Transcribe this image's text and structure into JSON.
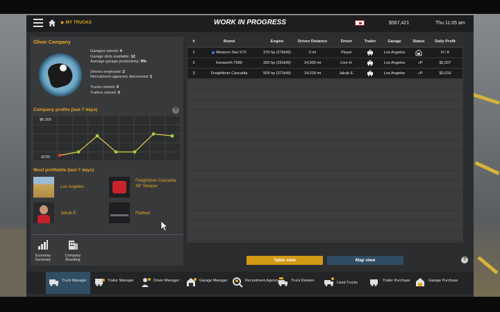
{
  "header": {
    "breadcrumb": "MY TRUCKS",
    "title": "WORK IN PROGRESS",
    "money": "$567,421",
    "time": "Thu 11:05 am"
  },
  "company": {
    "name": "Oliver Company",
    "stats": [
      {
        "label": "Garages owned:",
        "value": "4"
      },
      {
        "label": "Garage slots available:",
        "value": "12"
      },
      {
        "label": "Average garage productivity:",
        "value": "9%"
      },
      {
        "label": "Drivers employed:",
        "value": "2"
      },
      {
        "label": "Recruitment agencies discovered:",
        "value": "1"
      },
      {
        "label": "Trucks owned:",
        "value": "3"
      },
      {
        "label": "Trailers owned:",
        "value": "3"
      }
    ]
  },
  "profits": {
    "title": "Company profits (last 7 days)",
    "help": "?"
  },
  "chart_data": {
    "type": "line",
    "title": "Company profits (last 7 days)",
    "y_tick_labels": [
      "$6,300",
      "-$700"
    ],
    "ylim": [
      -700,
      6300
    ],
    "values": [
      -700,
      0,
      3300,
      0,
      0,
      3700,
      3300
    ],
    "colors": {
      "line": "#e6d24a",
      "point_positive": "#9ad23a",
      "point_negative": "#e23b2e"
    },
    "grid": true
  },
  "most_profitable": {
    "title": "Most profitable (last 7 days)",
    "items": [
      {
        "label": "Los Angeles",
        "icon": "garage-image"
      },
      {
        "label": "Freightliner Cascadia 48\" Sleeper",
        "icon": "truck-image"
      },
      {
        "label": "Jakub E.",
        "icon": "driver-portrait"
      },
      {
        "label": "Flatbed",
        "icon": "trailer-image"
      }
    ]
  },
  "tools": [
    {
      "label": "Economy Summary",
      "icon": "bar-chart-icon"
    },
    {
      "label": "Company Branding",
      "icon": "building-icon"
    }
  ],
  "table": {
    "columns": [
      "#",
      "Brand",
      "Engine",
      "Driven Distance",
      "Driver",
      "Trailer",
      "Garage",
      "Status",
      "Daily Profit"
    ],
    "rows": [
      {
        "num": "1",
        "brand": "Western Star 57X",
        "engine": "370 hp (276kW)",
        "distance": "0 mi",
        "driver": "Player",
        "garage": "Los Angeles",
        "status": "",
        "profit": "N / A",
        "active": true
      },
      {
        "num": "2",
        "brand": "Kenworth T680",
        "engine": "350 hp (261kW)",
        "distance": "14,005 mi",
        "driver": "Lien H.",
        "garage": "Los Angeles",
        "status": "P",
        "profit": "$2,007",
        "active": false
      },
      {
        "num": "3",
        "brand": "Freightliner Cascadia",
        "engine": "505 hp (371kW)",
        "distance": "14,018 mi",
        "driver": "Jakub E.",
        "garage": "Los Angeles",
        "status": "P",
        "profit": "$3,010",
        "active": false
      }
    ],
    "empty_rows": 16
  },
  "views": {
    "table": "Table view",
    "map": "Map view",
    "help": "?"
  },
  "bottom_nav": [
    {
      "label": "Truck Manager",
      "icon": "truck-manager-icon",
      "active": true
    },
    {
      "label": "Trailer Manager",
      "icon": "trailer-manager-icon",
      "active": false
    },
    {
      "label": "Driver Manager",
      "icon": "driver-manager-icon",
      "active": false
    },
    {
      "label": "Garage Manager",
      "icon": "garage-manager-icon",
      "active": false
    },
    {
      "label": "Recruitment Agency",
      "icon": "recruitment-icon",
      "active": false
    },
    {
      "label": "Truck Dealers",
      "icon": "truck-dealers-icon",
      "active": false
    },
    {
      "label": "Used Trucks",
      "icon": "used-trucks-icon",
      "active": false
    },
    {
      "label": "Trailer Purchase",
      "icon": "trailer-purchase-icon",
      "active": false
    },
    {
      "label": "Garage Purchase",
      "icon": "garage-purchase-icon",
      "active": false
    }
  ],
  "colors": {
    "accent": "#e6a824",
    "active_button": "#d39a16",
    "inactive_button": "#2f4d63"
  }
}
